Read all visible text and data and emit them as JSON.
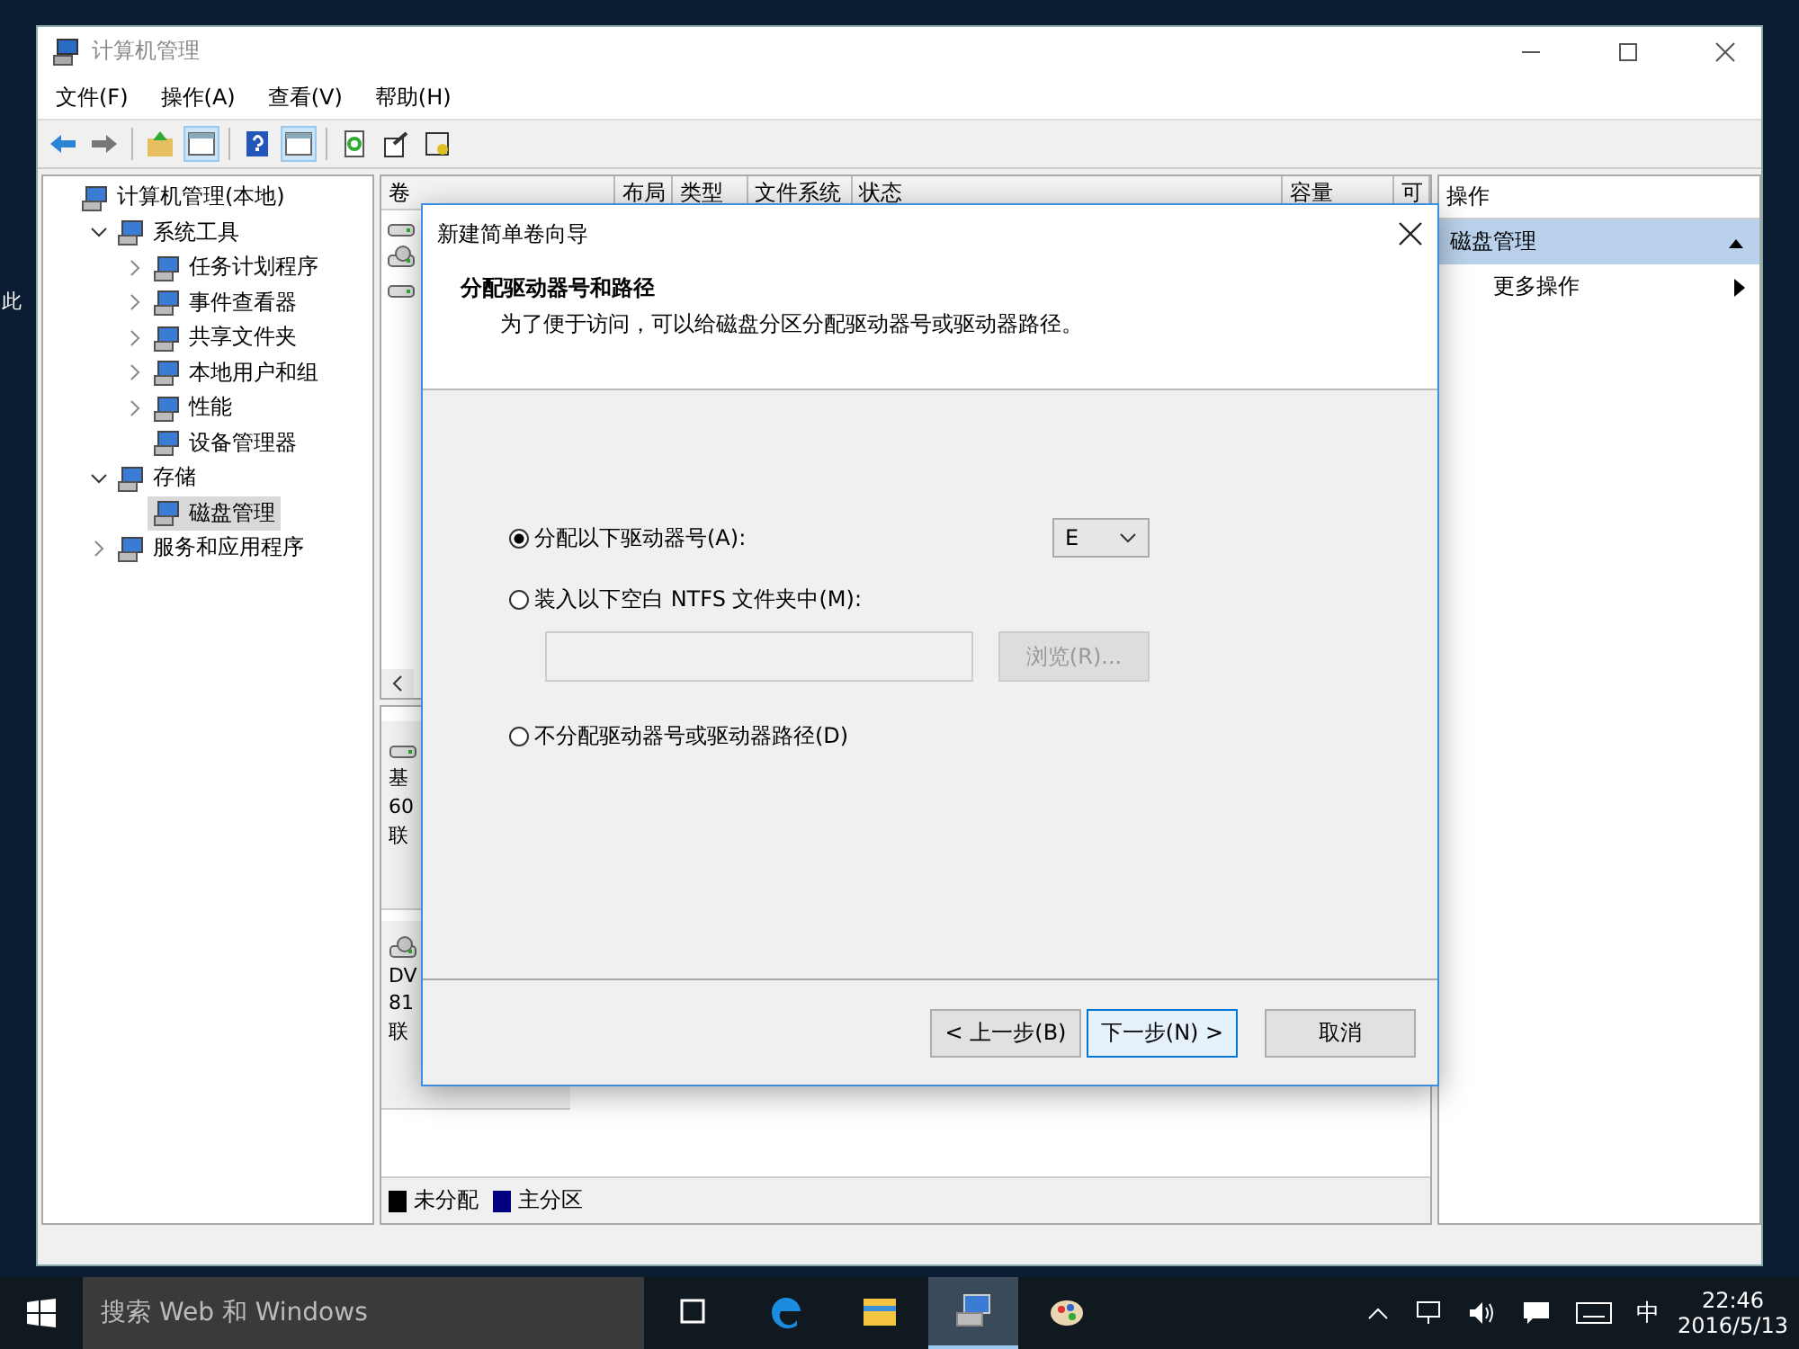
{
  "desktop": {
    "icon_label": "此"
  },
  "window": {
    "title": "计算机管理"
  },
  "menu": [
    "文件(F)",
    "操作(A)",
    "查看(V)",
    "帮助(H)"
  ],
  "toolbar": [
    {
      "kind": "back",
      "selected": false
    },
    {
      "kind": "forward",
      "selected": false
    },
    {
      "kind": "up",
      "selected": false
    },
    {
      "kind": "pane",
      "selected": true
    },
    {
      "kind": "help",
      "selected": false
    },
    {
      "kind": "pane",
      "selected": true
    },
    {
      "kind": "refresh",
      "selected": false
    },
    {
      "kind": "export",
      "selected": false
    },
    {
      "kind": "props",
      "selected": false
    }
  ],
  "tree": [
    {
      "label": "计算机管理(本地)",
      "selected": false,
      "children": [
        {
          "label": "系统工具",
          "selected": false,
          "expanded": true,
          "children": [
            {
              "label": "任务计划程序",
              "selected": false,
              "expanded": false
            },
            {
              "label": "事件查看器",
              "selected": false,
              "expanded": false
            },
            {
              "label": "共享文件夹",
              "selected": false,
              "expanded": false
            },
            {
              "label": "本地用户和组",
              "selected": false,
              "expanded": false
            },
            {
              "label": "性能",
              "selected": false,
              "expanded": false
            },
            {
              "label": "设备管理器",
              "selected": false
            }
          ]
        },
        {
          "label": "存储",
          "selected": false,
          "expanded": true,
          "children": [
            {
              "label": "磁盘管理",
              "selected": true
            }
          ]
        },
        {
          "label": "服务和应用程序",
          "selected": false,
          "expanded": false
        }
      ]
    }
  ],
  "volume_table": {
    "columns": [
      "卷",
      "布局",
      "类型",
      "文件系统",
      "状态",
      "容量",
      "可"
    ],
    "row_count_icons": [
      {
        "kind": "disk"
      },
      {
        "kind": "cd"
      },
      {
        "kind": "disk"
      }
    ]
  },
  "disks": [
    {
      "lines": [
        "基",
        "60",
        "联"
      ],
      "kind": "disk"
    },
    {
      "lines": [
        "DV",
        "81",
        "联"
      ],
      "kind": "cd"
    }
  ],
  "legend": [
    {
      "label": "未分配",
      "color": "#000000"
    },
    {
      "label": "主分区",
      "color": "#000080"
    }
  ],
  "actions": {
    "header": "操作",
    "section": "磁盘管理",
    "expanded": true,
    "items": [
      "更多操作"
    ]
  },
  "dialog": {
    "title": "新建简单卷向导",
    "heading": "分配驱动器号和路径",
    "description": "为了便于访问，可以给磁盘分区分配驱动器号或驱动器路径。",
    "options": [
      {
        "kind": "letter",
        "label": "分配以下驱动器号(A):",
        "selected": true,
        "value": "E"
      },
      {
        "kind": "folder",
        "label": "装入以下空白 NTFS 文件夹中(M):",
        "selected": false,
        "button": "浏览(R)...",
        "disabled": true
      },
      {
        "kind": "plain",
        "label": "不分配驱动器号或驱动器路径(D)",
        "selected": false
      }
    ],
    "buttons": [
      {
        "label": "< 上一步(B)",
        "default": false
      },
      {
        "label": "下一步(N) >",
        "default": true
      },
      {
        "label": "取消",
        "default": false
      }
    ]
  },
  "taskbar": {
    "search_placeholder": "搜索 Web 和 Windows",
    "apps": [
      {
        "kind": "taskview",
        "selected": false
      },
      {
        "kind": "edge",
        "selected": false
      },
      {
        "kind": "explorer",
        "selected": false
      },
      {
        "kind": "mmc",
        "selected": true
      },
      {
        "kind": "paint",
        "selected": false
      }
    ],
    "ime": "中",
    "time": "22:46",
    "date": "2016/5/13"
  }
}
